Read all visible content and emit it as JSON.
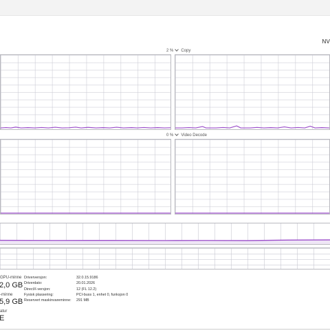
{
  "header": {
    "gpu_name_partial": "NV"
  },
  "engines": [
    {
      "pct": "2 %",
      "name": "Copy"
    },
    {
      "pct": "0 %",
      "name": "Video Decode"
    }
  ],
  "stats": {
    "dedicated_label": "GPU-minne",
    "dedicated_value": "2,0 GB",
    "shared_label": "-minne",
    "shared_value": "5,9 GB",
    "temp_label": "atur",
    "temp_value": "E"
  },
  "properties": [
    {
      "label": "Driverversjon:",
      "value": "32.0.15.9186"
    },
    {
      "label": "Driverdato:",
      "value": "20.01.2026"
    },
    {
      "label": "DirectX-versjon:",
      "value": "12 (FL 12.2)"
    },
    {
      "label": "Fysisk plassering:",
      "value": "PCI-buss 1, enhet 0, funksjon 0"
    },
    {
      "label": "Reservert maskinvareminne:",
      "value": "291 MB"
    }
  ],
  "colors": {
    "accent": "#9b4dca",
    "grid": "#c8c8d2",
    "border": "#b9b9bf"
  }
}
